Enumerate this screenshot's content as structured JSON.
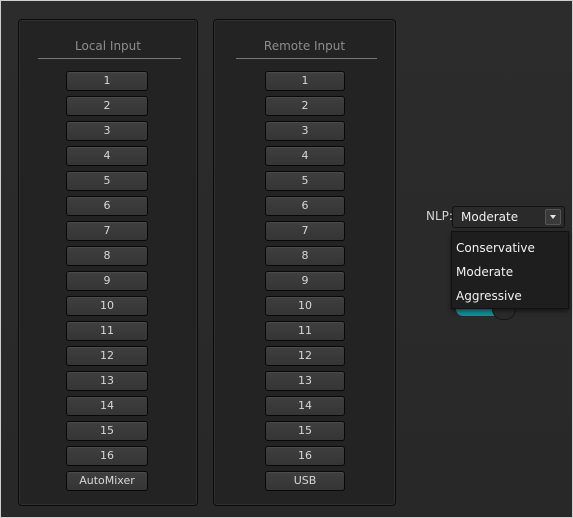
{
  "local_panel": {
    "title": "Local Input",
    "buttons": [
      "1",
      "2",
      "3",
      "4",
      "5",
      "6",
      "7",
      "8",
      "9",
      "10",
      "11",
      "12",
      "13",
      "14",
      "15",
      "16",
      "AutoMixer"
    ]
  },
  "remote_panel": {
    "title": "Remote Input",
    "buttons": [
      "1",
      "2",
      "3",
      "4",
      "5",
      "6",
      "7",
      "8",
      "9",
      "10",
      "11",
      "12",
      "13",
      "14",
      "15",
      "16",
      "USB"
    ]
  },
  "nlp": {
    "label": "NLP:",
    "selected": "Moderate",
    "options": [
      "Conservative",
      "Moderate",
      "Aggressive"
    ]
  },
  "toggle": {
    "state": "on"
  },
  "colors": {
    "accent": "#0f8d98",
    "background": "#2a2a2a",
    "panel": "#232323",
    "button": "#3b3b3b"
  }
}
